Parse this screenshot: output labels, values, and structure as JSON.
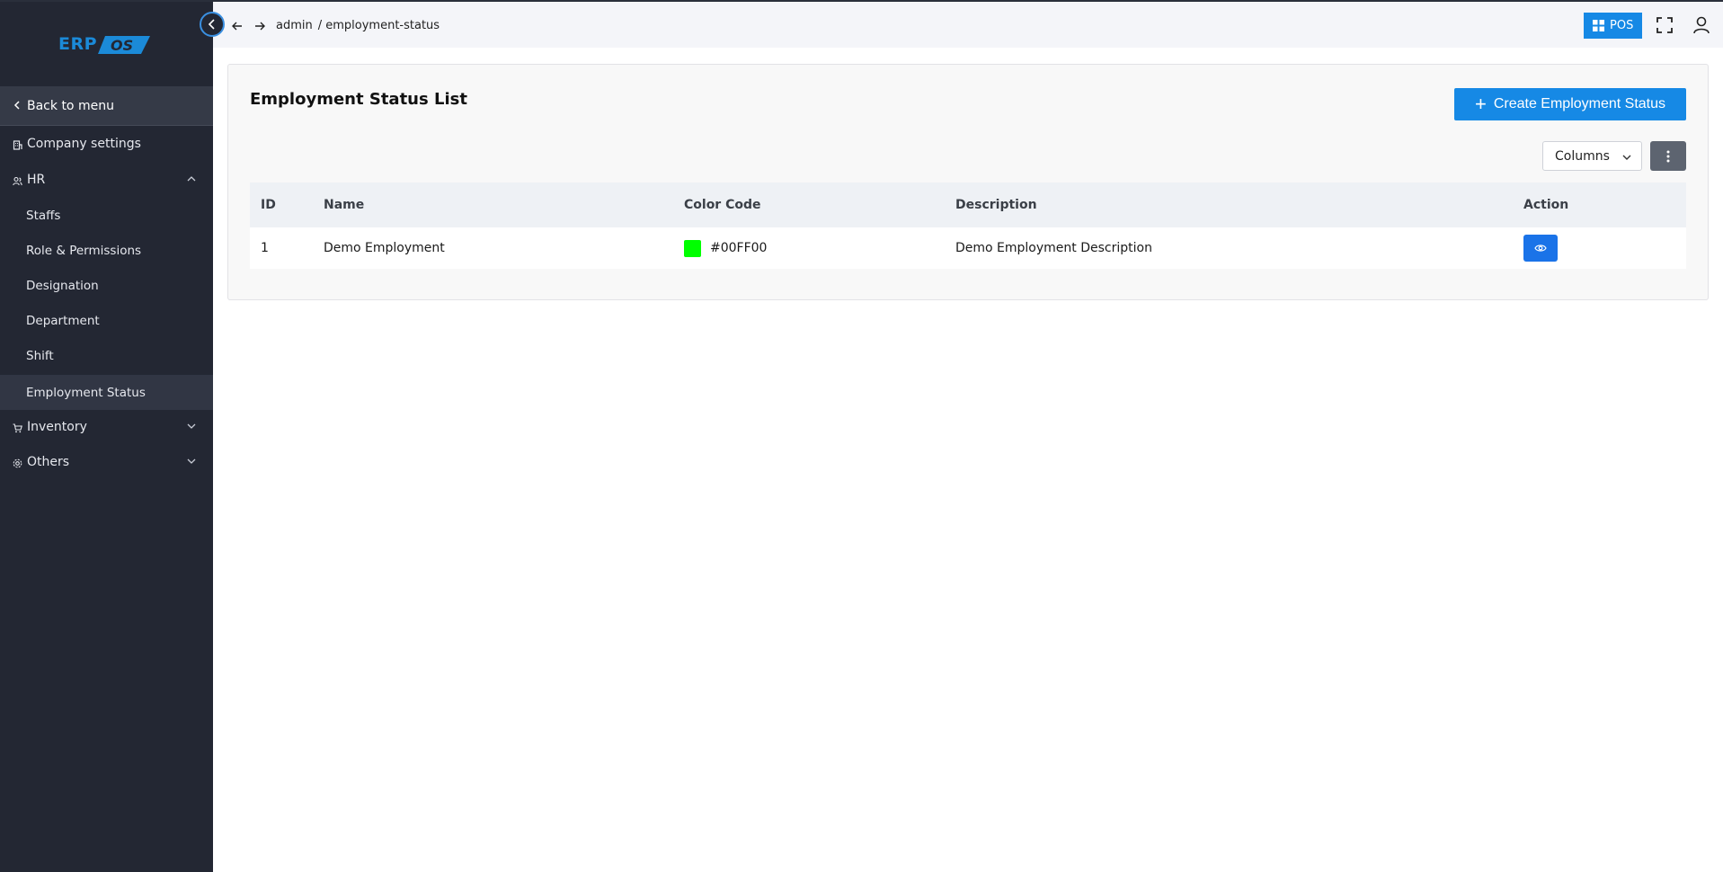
{
  "sidebar": {
    "logo_text": "ERP",
    "logo_mark_text": "OS",
    "back_label": "Back to menu",
    "items": [
      {
        "label": "Company settings",
        "icon": "building-icon"
      },
      {
        "label": "HR",
        "icon": "users-icon",
        "expanded": true
      },
      {
        "label": "Staffs"
      },
      {
        "label": "Role & Permissions"
      },
      {
        "label": "Designation"
      },
      {
        "label": "Department"
      },
      {
        "label": "Shift"
      },
      {
        "label": "Employment Status",
        "active": true
      },
      {
        "label": "Inventory",
        "icon": "cart-icon",
        "expanded": false
      },
      {
        "label": "Others",
        "icon": "gear-icon",
        "expanded": false
      }
    ]
  },
  "topbar": {
    "breadcrumb": [
      "admin",
      "/ employment-status"
    ],
    "pos_label": "POS"
  },
  "page": {
    "title": "Employment Status List",
    "create_label": "Create Employment Status",
    "columns_label": "Columns"
  },
  "table": {
    "headers": [
      "ID",
      "Name",
      "Color Code",
      "Description",
      "Action"
    ],
    "rows": [
      {
        "id": "1",
        "name": "Demo Employment",
        "color": "#00FF00",
        "color_label": "#00FF00",
        "description": "Demo Employment Description"
      }
    ]
  },
  "colors": {
    "accent": "#1689e5",
    "sidebar_bg": "#232733",
    "swatch": "#00FF00"
  }
}
